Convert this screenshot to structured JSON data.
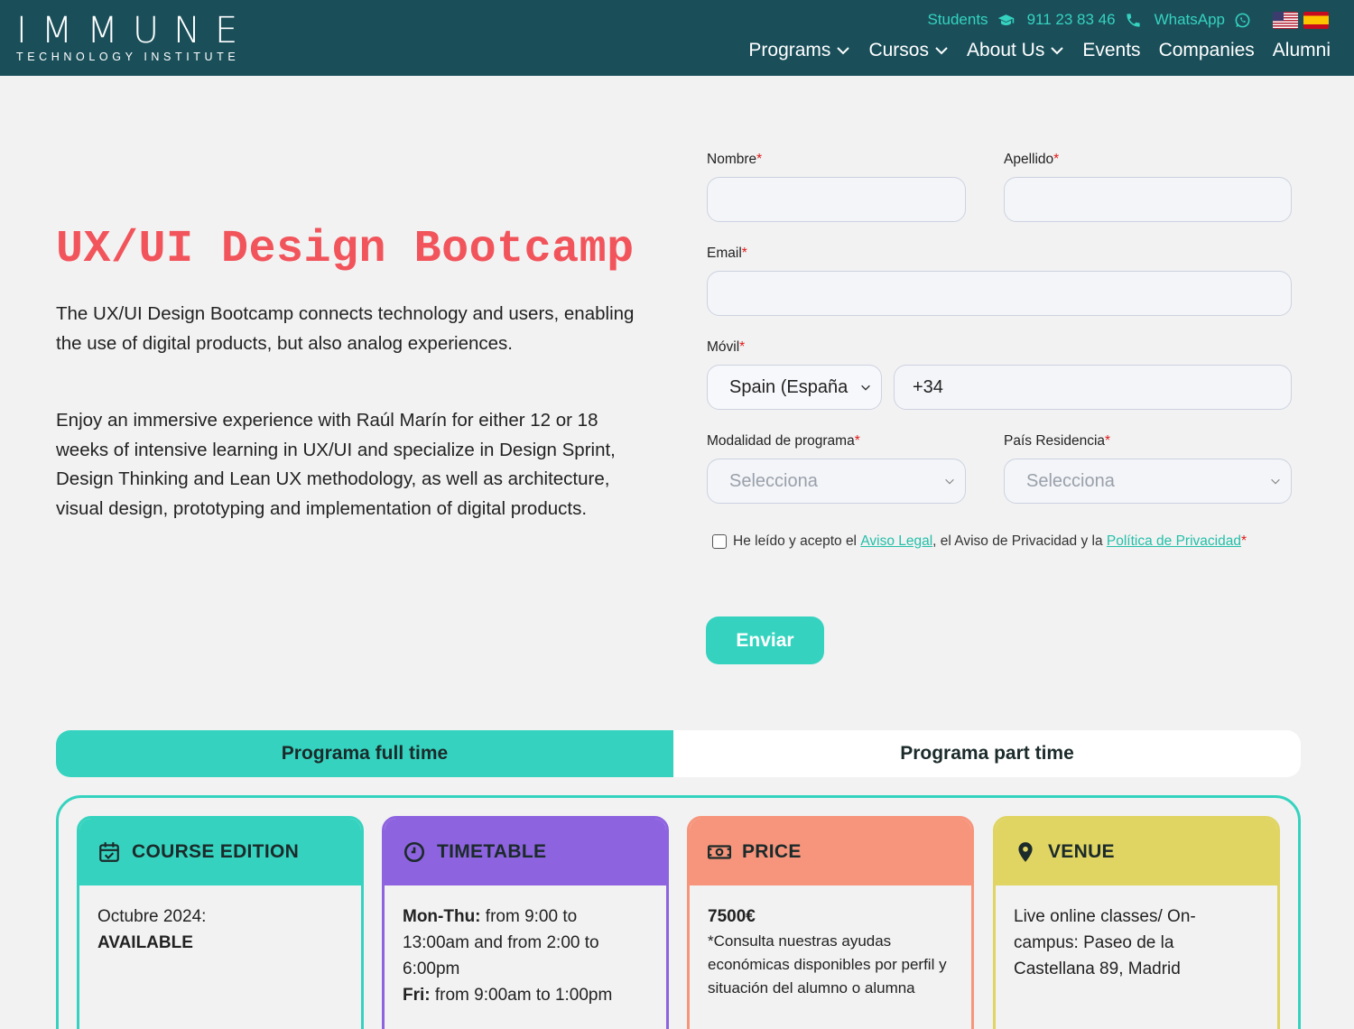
{
  "header": {
    "logo": {
      "main": "IMMUNE",
      "sub": "TECHNOLOGY INSTITUTE"
    },
    "top_links": [
      {
        "label": "Students",
        "icon": "graduation-cap-icon"
      },
      {
        "label": "911 23 83 46",
        "icon": "phone-icon"
      },
      {
        "label": "WhatsApp",
        "icon": "whatsapp-icon"
      }
    ],
    "languages": [
      "us-flag",
      "es-flag"
    ],
    "nav": [
      {
        "label": "Programs",
        "dropdown": true
      },
      {
        "label": "Cursos",
        "dropdown": true
      },
      {
        "label": "About Us",
        "dropdown": true
      },
      {
        "label": "Events",
        "dropdown": false
      },
      {
        "label": "Companies",
        "dropdown": false
      },
      {
        "label": "Alumni",
        "dropdown": false
      }
    ],
    "colors": {
      "bar": "#1a4f5a",
      "accent": "#35d3bf"
    }
  },
  "hero": {
    "title": "UX/UI Design Bootcamp",
    "p1": "The UX/UI Design Bootcamp connects technology and users, enabling the use of digital products, but also analog experiences.",
    "p2": "Enjoy an immersive experience with Raúl Marín for either 12 or 18 weeks of intensive learning in UX/UI and specialize in Design Sprint, Design Thinking and Lean UX methodology, as well as architecture, visual design, prototyping and implementation of digital products."
  },
  "form": {
    "nombre_label": "Nombre",
    "apellido_label": "Apellido",
    "email_label": "Email",
    "movil_label": "Móvil",
    "country_value": "Spain (España",
    "phone_value": "+34",
    "modalidad_label": "Modalidad de programa",
    "modalidad_placeholder": "Selecciona",
    "pais_label": "País Residencia",
    "pais_placeholder": "Selecciona",
    "required_mark": "*",
    "consent": {
      "text1": "He leído y acepto el ",
      "link1": "Aviso Legal",
      "text2": ", el Aviso de Privacidad y la ",
      "link2": "Política de Privacidad",
      "mark": "*"
    },
    "submit": "Enviar"
  },
  "tabs": [
    {
      "label": "Programa full time",
      "active": true
    },
    {
      "label": "Programa part time",
      "active": false
    }
  ],
  "cards": [
    {
      "title": "COURSE EDITION",
      "icon": "calendar-check-icon",
      "line1": "Octubre 2024:",
      "line2": "AVAILABLE",
      "color": "#35d3bf"
    },
    {
      "title": "TIMETABLE",
      "icon": "clock-icon",
      "b1": "Mon-Thu:",
      "t1": " from 9:00 to 13:00am and from 2:00 to 6:00pm",
      "b2": "Fri:",
      "t2": " from 9:00am to 1:00pm",
      "color": "#8e63e0"
    },
    {
      "title": "PRICE",
      "icon": "money-bill-icon",
      "price": "7500€",
      "note": "*Consulta nuestras ayudas económicas disponibles por perfil y situación del alumno o alumna",
      "color": "#f7957c"
    },
    {
      "title": "VENUE",
      "icon": "map-pin-icon",
      "text": "Live online classes/ On-campus: Paseo de la Castellana 89, Madrid",
      "color": "#e0d462"
    }
  ]
}
